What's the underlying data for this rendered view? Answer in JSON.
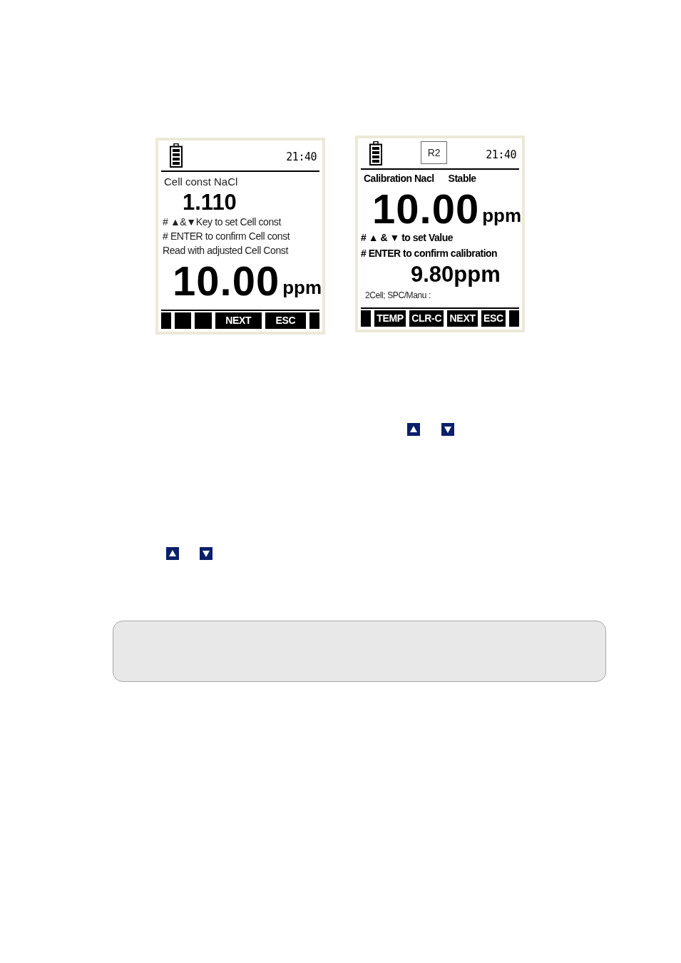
{
  "screens": [
    {
      "header": {
        "time": "21:40"
      },
      "rows": [
        {
          "kind": "caption",
          "text": "Cell const NaCl"
        },
        {
          "kind": "value",
          "text": "1.110"
        },
        {
          "kind": "hint",
          "text": "# ▲&▼Key to set Cell const"
        },
        {
          "kind": "hint",
          "text": "# ENTER to confirm Cell const"
        },
        {
          "kind": "hint",
          "text": "Read with adjusted Cell Const"
        },
        {
          "kind": "reading",
          "value": "10.00",
          "unit": "ppm"
        }
      ],
      "softkeys": [
        {
          "kind": "edge"
        },
        {
          "kind": "blank"
        },
        {
          "kind": "blank"
        },
        {
          "kind": "key",
          "label": "NEXT"
        },
        {
          "kind": "key",
          "label": "ESC"
        },
        {
          "kind": "edge"
        }
      ]
    },
    {
      "header": {
        "badge": "R2",
        "time": "21:40"
      },
      "rows": [
        {
          "kind": "status",
          "text": "Calibration Nacl",
          "status": "Stable"
        },
        {
          "kind": "reading",
          "value": "10.00",
          "unit": "ppm"
        },
        {
          "kind": "lcd-hint",
          "text": "# ▲ & ▼ to set Value"
        },
        {
          "kind": "lcd-hint",
          "text": "# ENTER to confirm calibration"
        },
        {
          "kind": "target",
          "text": "9.80ppm"
        },
        {
          "kind": "footnote",
          "text": "2Cell; SPC/Manu :"
        }
      ],
      "softkeys": [
        {
          "kind": "edge"
        },
        {
          "kind": "key",
          "label": "TEMP"
        },
        {
          "kind": "key",
          "label": "CLR-C"
        },
        {
          "kind": "key",
          "label": "NEXT"
        },
        {
          "kind": "key",
          "label": "ESC"
        },
        {
          "kind": "edge"
        }
      ]
    }
  ]
}
